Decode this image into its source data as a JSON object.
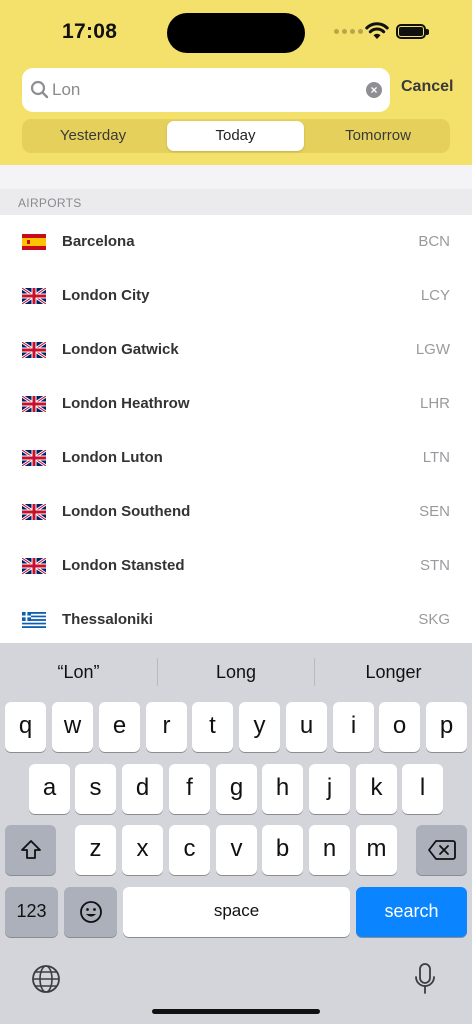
{
  "status_bar": {
    "time": "17:08"
  },
  "search": {
    "value": "Lon",
    "cancel_label": "Cancel"
  },
  "day_tabs": [
    {
      "label": "Yesterday",
      "active": false
    },
    {
      "label": "Today",
      "active": true
    },
    {
      "label": "Tomorrow",
      "active": false
    }
  ],
  "section_title": "AIRPORTS",
  "airports": [
    {
      "name": "Barcelona",
      "code": "BCN",
      "flag": "es"
    },
    {
      "name": "London City",
      "code": "LCY",
      "flag": "gb"
    },
    {
      "name": "London Gatwick",
      "code": "LGW",
      "flag": "gb"
    },
    {
      "name": "London Heathrow",
      "code": "LHR",
      "flag": "gb"
    },
    {
      "name": "London Luton",
      "code": "LTN",
      "flag": "gb"
    },
    {
      "name": "London Southend",
      "code": "SEN",
      "flag": "gb"
    },
    {
      "name": "London Stansted",
      "code": "STN",
      "flag": "gb"
    },
    {
      "name": "Thessaloniki",
      "code": "SKG",
      "flag": "gr"
    }
  ],
  "keyboard": {
    "suggestions": [
      "“Lon”",
      "Long",
      "Longer"
    ],
    "row1": [
      "q",
      "w",
      "e",
      "r",
      "t",
      "y",
      "u",
      "i",
      "o",
      "p"
    ],
    "row2": [
      "a",
      "s",
      "d",
      "f",
      "g",
      "h",
      "j",
      "k",
      "l"
    ],
    "row3": [
      "z",
      "x",
      "c",
      "v",
      "b",
      "n",
      "m"
    ],
    "numbers_label": "123",
    "space_label": "space",
    "return_label": "search"
  },
  "colors": {
    "header": "#f4e16b",
    "accent": "#0a84ff"
  }
}
